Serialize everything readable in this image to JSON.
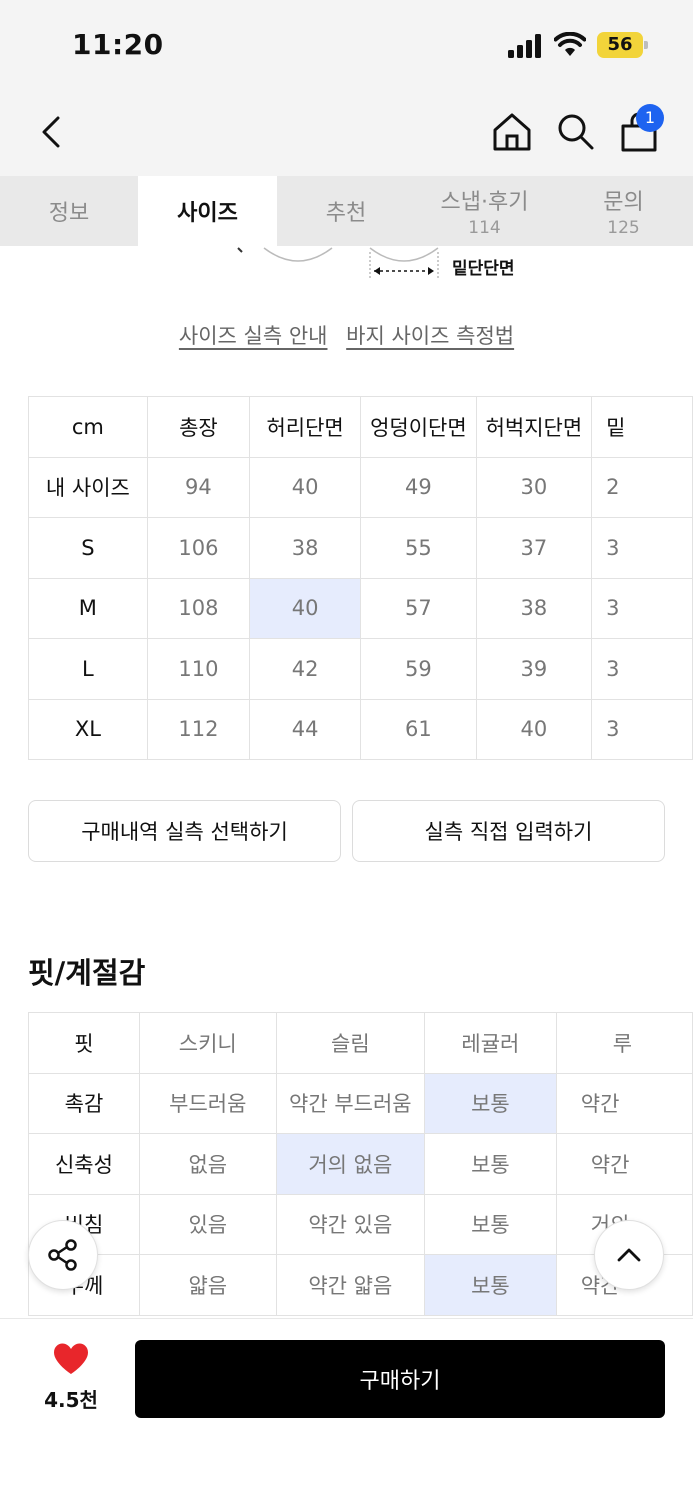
{
  "status_bar": {
    "time": "11:20",
    "battery": "56"
  },
  "header": {
    "cart_count": "1"
  },
  "tabs": [
    {
      "label": "정보",
      "count": ""
    },
    {
      "label": "사이즈",
      "count": ""
    },
    {
      "label": "추천",
      "count": ""
    },
    {
      "label": "스냅·후기",
      "count": "114"
    },
    {
      "label": "문의",
      "count": "125"
    }
  ],
  "diagram": {
    "label": "밑단단면"
  },
  "links": {
    "size_guide": "사이즈 실측 안내",
    "pants_measure": "바지 사이즈 측정법"
  },
  "size_table": {
    "headers": [
      "cm",
      "총장",
      "허리단면",
      "엉덩이단면",
      "허벅지단면",
      "밑"
    ],
    "rows": [
      {
        "label": "내 사이즈",
        "values": [
          "94",
          "40",
          "49",
          "30",
          "2"
        ]
      },
      {
        "label": "S",
        "values": [
          "106",
          "38",
          "55",
          "37",
          "3"
        ]
      },
      {
        "label": "M",
        "values": [
          "108",
          "40",
          "57",
          "38",
          "3"
        ]
      },
      {
        "label": "L",
        "values": [
          "110",
          "42",
          "59",
          "39",
          "3"
        ]
      },
      {
        "label": "XL",
        "values": [
          "112",
          "44",
          "61",
          "40",
          "3"
        ]
      }
    ]
  },
  "buttons": {
    "purchase_history": "구매내역 실측 선택하기",
    "manual_input": "실측 직접 입력하기"
  },
  "fit_section": {
    "title": "핏/계절감"
  },
  "fit_table": {
    "rows": [
      {
        "label": "핏",
        "values": [
          "스키니",
          "슬림",
          "레귤러",
          "루"
        ]
      },
      {
        "label": "촉감",
        "values": [
          "부드러움",
          "약간 부드러움",
          "보통",
          "약간"
        ]
      },
      {
        "label": "신축성",
        "values": [
          "없음",
          "거의 없음",
          "보통",
          "약간"
        ]
      },
      {
        "label": "비침",
        "values": [
          "있음",
          "약간 있음",
          "보통",
          "거의"
        ]
      },
      {
        "label": "두께",
        "values": [
          "얇음",
          "약간 얇음",
          "보통",
          "약간"
        ]
      }
    ]
  },
  "bottom_bar": {
    "like_count": "4.5천",
    "buy_label": "구매하기"
  },
  "colors": {
    "accent_blue": "#1e63f0",
    "highlight": "#e6ecfd",
    "heart": "#e8262b",
    "battery": "#f2d43a"
  },
  "icons": [
    "back-icon",
    "home-icon",
    "search-icon",
    "cart-icon",
    "share-icon",
    "chevron-up-icon",
    "heart-icon"
  ]
}
